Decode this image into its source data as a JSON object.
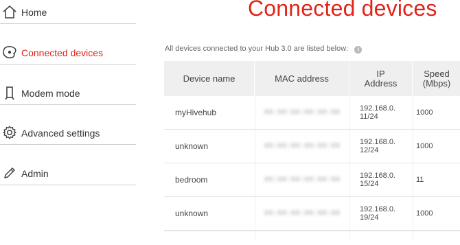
{
  "sidebar": {
    "items": [
      {
        "label": "Home",
        "icon": "home-icon",
        "active": false
      },
      {
        "label": "Connected devices",
        "icon": "devices-icon",
        "active": true
      },
      {
        "label": "Modem mode",
        "icon": "modem-icon",
        "active": false
      },
      {
        "label": "Advanced settings",
        "icon": "gear-icon",
        "active": false
      },
      {
        "label": "Admin",
        "icon": "pencil-icon",
        "active": false
      }
    ]
  },
  "main": {
    "title": "Connected devices",
    "intro": "All devices connected to your Hub 3.0 are listed below:",
    "info_icon": "i",
    "table": {
      "headers": [
        "Device name",
        "MAC address",
        "IP\nAddress",
        "Speed\n(Mbps)"
      ],
      "rows": [
        {
          "name": "myHivehub",
          "mac": "XX:XX:XX:XX:XX:XX",
          "ip": "192.168.0.\n11/24",
          "speed": "1000"
        },
        {
          "name": "unknown",
          "mac": "XX:XX:XX:XX:XX:XX",
          "ip": "192.168.0.\n12/24",
          "speed": "1000"
        },
        {
          "name": "bedroom",
          "mac": "XX:XX:XX:XX:XX:XX",
          "ip": "192.168.0.\n15/24",
          "speed": "11"
        },
        {
          "name": "unknown",
          "mac": "XX:XX:XX:XX:XX:XX",
          "ip": "192.168.0.\n19/24",
          "speed": "1000"
        }
      ]
    }
  },
  "colors": {
    "accent": "#e2231a",
    "header_bg": "#efefef",
    "divider": "#cfcfcf"
  }
}
